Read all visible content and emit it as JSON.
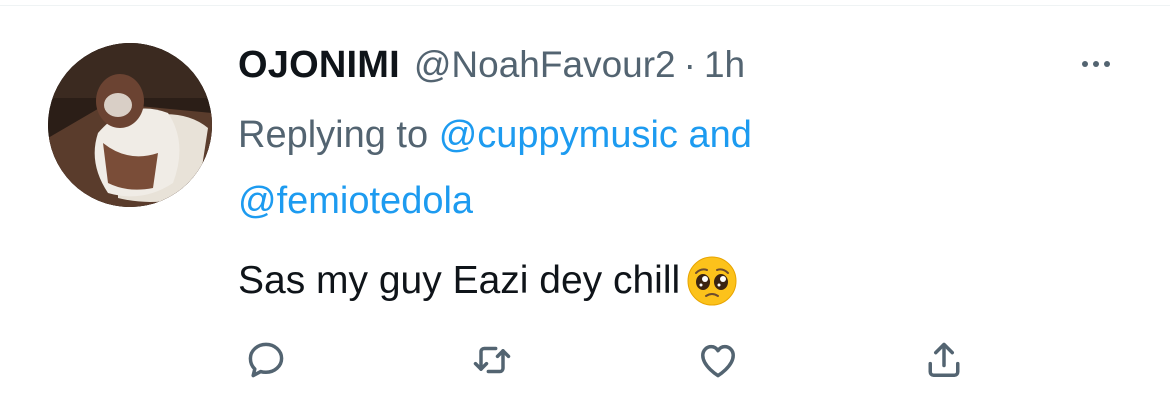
{
  "tweet": {
    "author_name": "OJONIMI",
    "author_handle": "@NoahFavour2",
    "separator": "·",
    "time": "1h",
    "replying_label": "Replying to",
    "mention_1": "@cuppymusic",
    "and_label": "and",
    "mention_2": "@femiotedola",
    "text": "Sas my guy Eazi dey chill",
    "emoji": "pleading-face-emoji"
  },
  "actions": [
    "reply-icon",
    "retweet-icon",
    "like-icon",
    "share-icon"
  ],
  "colors": {
    "name": "#0f1419",
    "muted": "#536471",
    "link": "#1d9bf0",
    "icon": "#536471"
  }
}
